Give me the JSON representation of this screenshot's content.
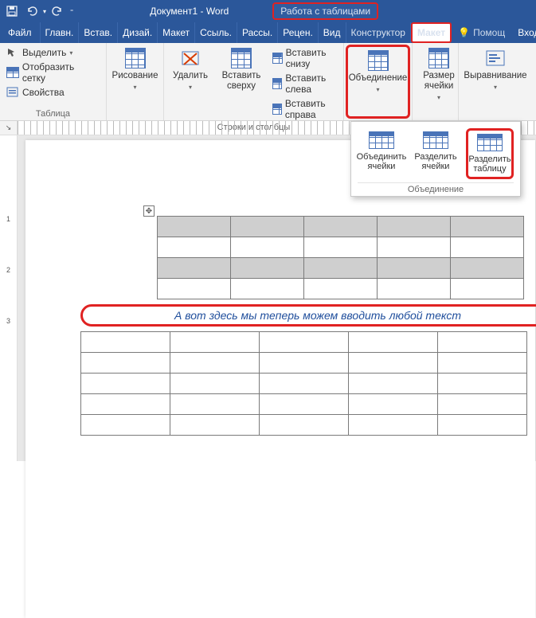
{
  "titlebar": {
    "doc_title": "Документ1 - Word",
    "context_tab": "Работа с таблицами"
  },
  "tabs": {
    "file": "Файл",
    "items": [
      "Главн.",
      "Встав.",
      "Дизай.",
      "Макет",
      "Ссыль.",
      "Рассы.",
      "Рецен.",
      "Вид"
    ],
    "context": [
      "Конструктор",
      "Макет"
    ],
    "active_context_index": 1,
    "help": "Помощ",
    "login": "Вход"
  },
  "ribbon": {
    "table_group": {
      "select": "Выделить",
      "gridlines": "Отобразить сетку",
      "properties": "Свойства",
      "label": "Таблица"
    },
    "draw": {
      "label": "Рисование"
    },
    "rows_cols": {
      "delete": "Удалить",
      "insert_above": "Вставить\nсверху",
      "insert_below": "Вставить снизу",
      "insert_left": "Вставить слева",
      "insert_right": "Вставить справа",
      "label": "Строки и столбцы"
    },
    "merge": {
      "label": "Объединение"
    },
    "cellsize": {
      "label": "Размер\nячейки"
    },
    "align": {
      "label": "Выравнивание"
    }
  },
  "gallery": {
    "merge_cells": "Объединить\nячейки",
    "split_cells": "Разделить\nячейки",
    "split_table": "Разделить\nтаблицу",
    "group_label": "Объединение"
  },
  "vruler_vals": [
    "1",
    "",
    "2",
    "",
    "3"
  ],
  "document": {
    "between_text": "А вот здесь мы теперь можем вводить любой текст"
  }
}
